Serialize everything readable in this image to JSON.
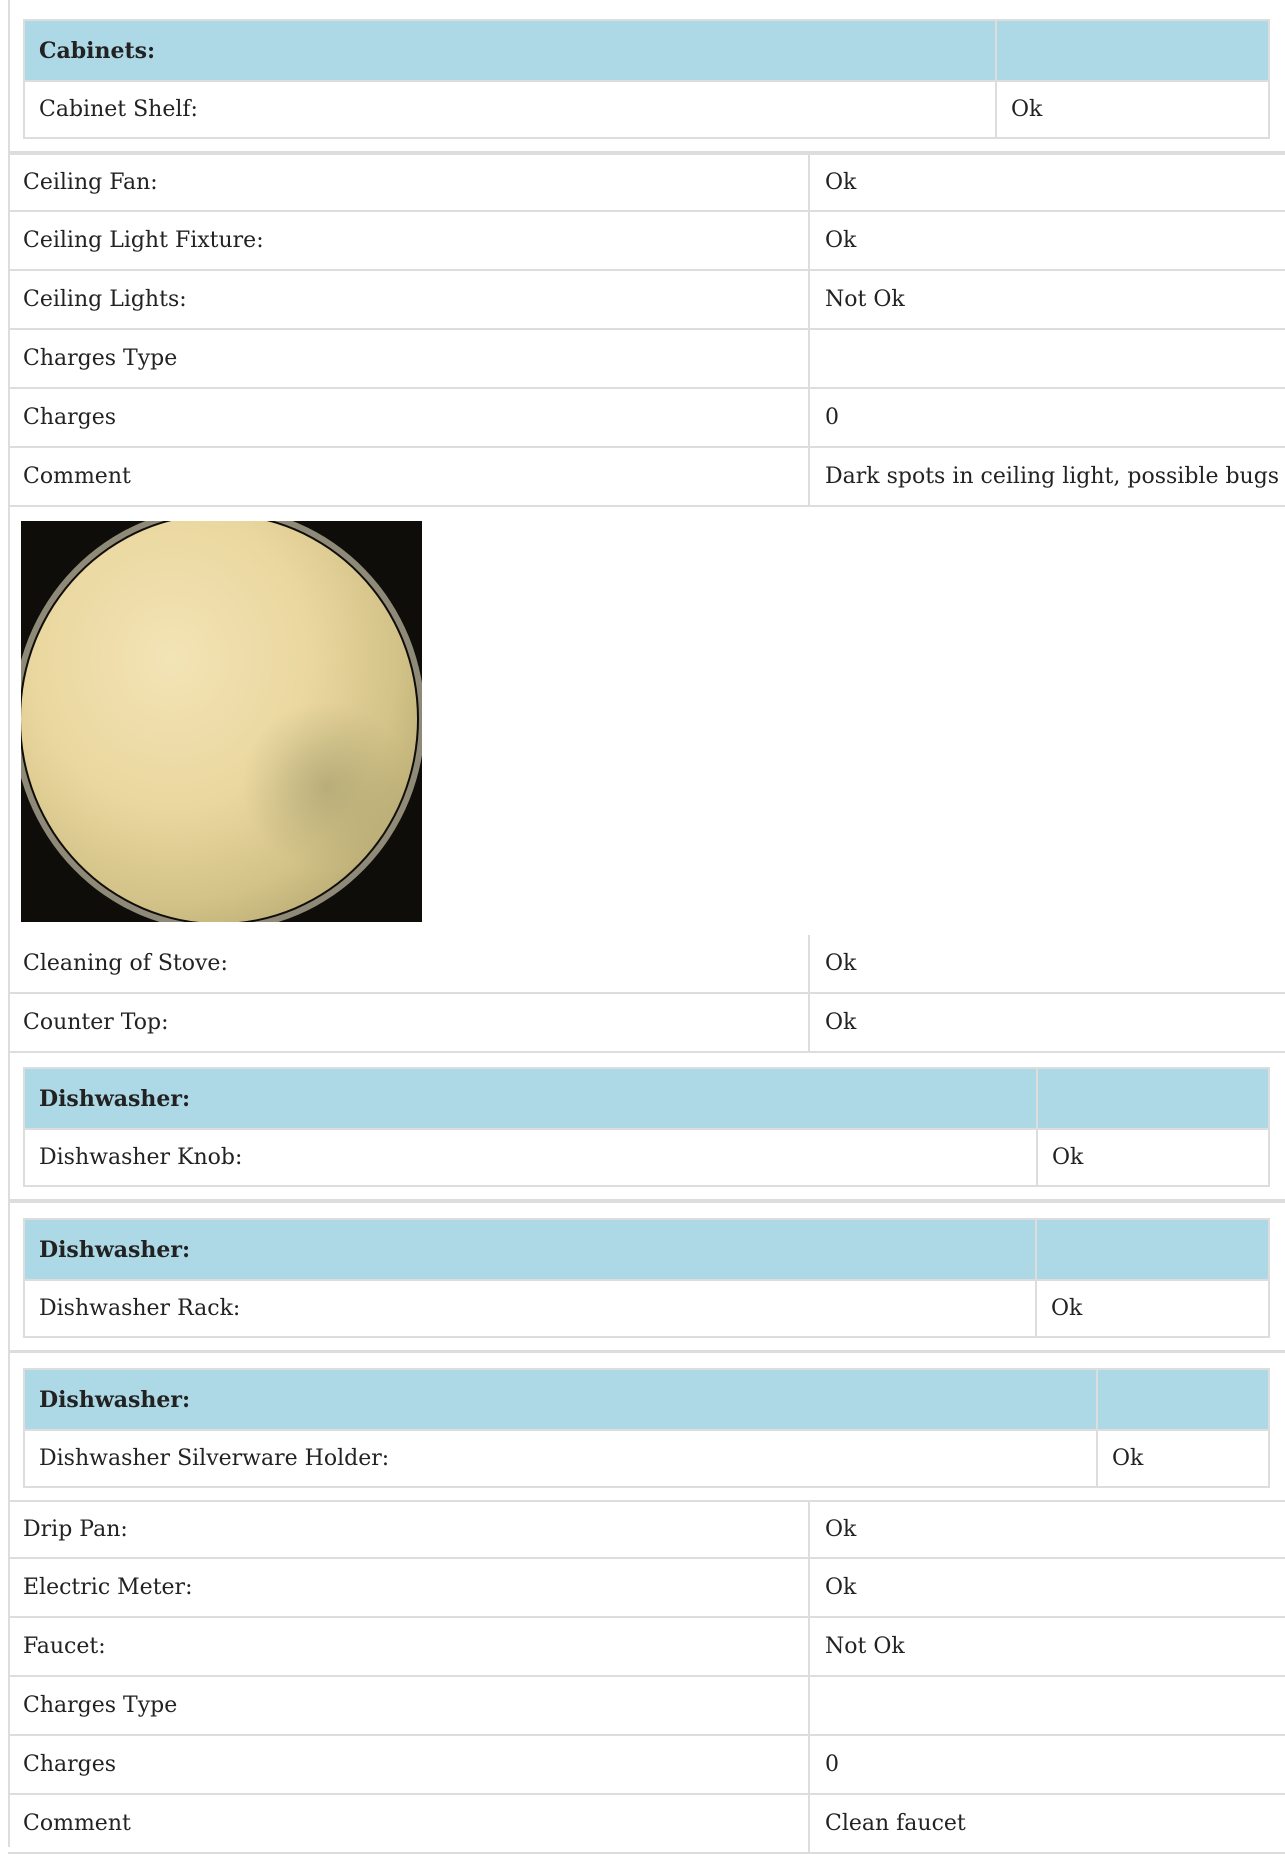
{
  "cabinets_group": {
    "title": "Cabinets:",
    "item_label": "Cabinet Shelf:",
    "item_value": "Ok"
  },
  "rows_a": [
    {
      "label": "Ceiling Fan:",
      "value": "Ok"
    },
    {
      "label": "Ceiling Light Fixture:",
      "value": "Ok"
    },
    {
      "label": "Ceiling Lights:",
      "value": "Not Ok"
    },
    {
      "label": "Charges Type",
      "value": ""
    },
    {
      "label": "Charges",
      "value": "0"
    },
    {
      "label": "Comment",
      "value": "Dark spots in ceiling light, possible bugs"
    }
  ],
  "rows_b": [
    {
      "label": "Cleaning of Stove:",
      "value": "Ok"
    },
    {
      "label": "Counter Top:",
      "value": "Ok"
    }
  ],
  "dishwasher_groups": [
    {
      "title": "Dishwasher:",
      "item_label": "Dishwasher Knob:",
      "item_value": "Ok"
    },
    {
      "title": "Dishwasher:",
      "item_label": "Dishwasher Rack:",
      "item_value": "Ok"
    },
    {
      "title": "Dishwasher:",
      "item_label": "Dishwasher Silverware Holder:",
      "item_value": "Ok"
    }
  ],
  "rows_c": [
    {
      "label": "Drip Pan:",
      "value": "Ok"
    },
    {
      "label": "Electric Meter:",
      "value": "Ok"
    },
    {
      "label": "Faucet:",
      "value": "Not Ok"
    },
    {
      "label": "Charges Type",
      "value": ""
    },
    {
      "label": "Charges",
      "value": "0"
    },
    {
      "label": "Comment",
      "value": "Clean faucet"
    }
  ]
}
